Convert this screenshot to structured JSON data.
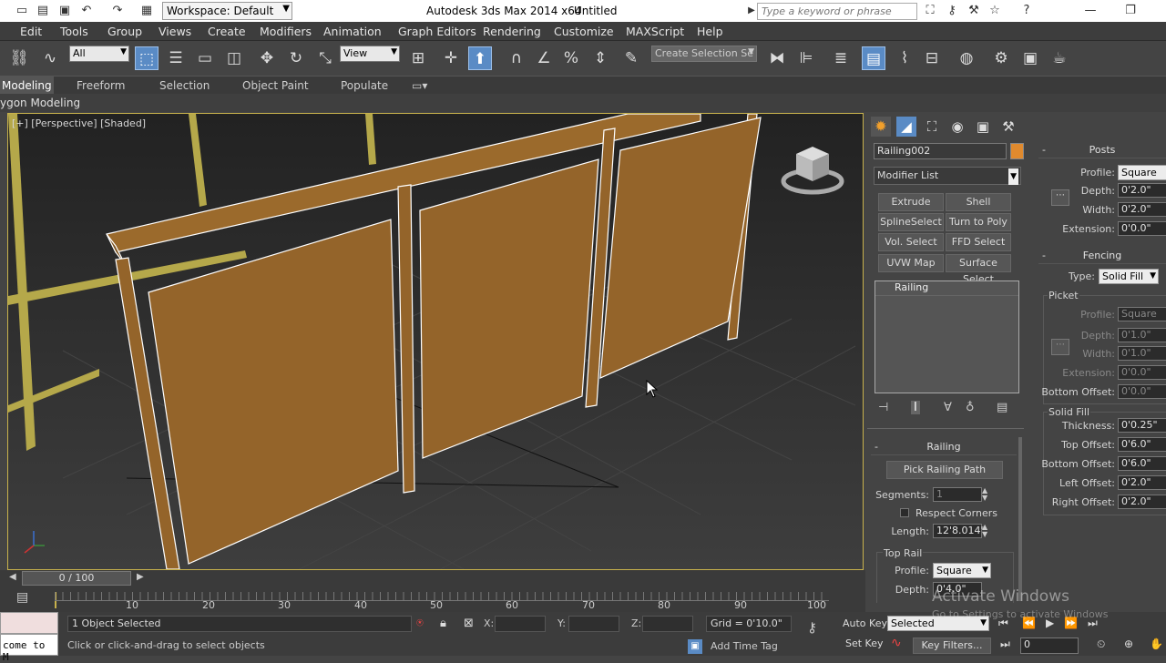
{
  "titlebar": {
    "workspace": "Workspace: Default",
    "title": "Autodesk 3ds Max  2014 x64",
    "file": "Untitled",
    "search_placeholder": "Type a keyword or phrase"
  },
  "menu": [
    "Edit",
    "Tools",
    "Group",
    "Views",
    "Create",
    "Modifiers",
    "Animation",
    "Graph Editors",
    "Rendering",
    "Customize",
    "MAXScript",
    "Help"
  ],
  "toolbar": {
    "filter_value": "All",
    "refcoord_value": "View",
    "selection_set_placeholder": "Create Selection Se"
  },
  "ribbon": {
    "tabs": [
      "Modeling",
      "Freeform",
      "Selection",
      "Object Paint",
      "Populate"
    ],
    "subtitle": "ygon Modeling"
  },
  "viewport": {
    "label": "[+] [Perspective] [Shaded]",
    "wood_color": "#94642a",
    "grid_color": "#3c3c3c",
    "border_color": "#c8b24c"
  },
  "command_panel": {
    "object_name": "Railing002",
    "object_color": "#e08a2e",
    "modifier_list": "Modifier List",
    "modifier_buttons": [
      "Extrude",
      "Shell",
      "SplineSelect",
      "Turn to Poly",
      "Vol. Select",
      "FFD Select",
      "UVW Map",
      "Surface Select"
    ],
    "stack_item": "Railing",
    "railing_rollout": {
      "title": "Railing",
      "pick_button": "Pick Railing Path",
      "segments_label": "Segments:",
      "segments_value": "1",
      "respect_corners": "Respect Corners",
      "length_label": "Length:",
      "length_value": "12'8.014\"",
      "top_rail_label": "Top Rail",
      "profile_label": "Profile:",
      "profile_value": "Square",
      "depth_label": "Depth:",
      "depth_value": "0'4.0\""
    },
    "posts_rollout": {
      "title": "Posts",
      "profile_label": "Profile:",
      "profile_value": "Square",
      "depth_label": "Depth:",
      "depth_value": "0'2.0\"",
      "width_label": "Width:",
      "width_value": "0'2.0\"",
      "extension_label": "Extension:",
      "extension_value": "0'0.0\""
    },
    "fencing_rollout": {
      "title": "Fencing",
      "type_label": "Type:",
      "type_value": "Solid Fill",
      "picket_label": "Picket",
      "picket_profile_label": "Profile:",
      "picket_profile_value": "Square",
      "picket_depth_label": "Depth:",
      "picket_depth_value": "0'1.0\"",
      "picket_width_label": "Width:",
      "picket_width_value": "0'1.0\"",
      "picket_extension_label": "Extension:",
      "picket_extension_value": "0'0.0\"",
      "picket_bottom_offset_label": "Bottom Offset:",
      "picket_bottom_offset_value": "0'0.0\"",
      "solid_fill_label": "Solid Fill",
      "thickness_label": "Thickness:",
      "thickness_value": "0'0.25\"",
      "top_offset_label": "Top Offset:",
      "top_offset_value": "0'6.0\"",
      "bottom_offset_label": "Bottom Offset:",
      "bottom_offset_value": "0'6.0\"",
      "left_offset_label": "Left Offset:",
      "left_offset_value": "0'2.0\"",
      "right_offset_label": "Right Offset:",
      "right_offset_value": "0'2.0\""
    }
  },
  "timeline": {
    "frame_counter": "0 / 100",
    "ticks": [
      "10",
      "20",
      "30",
      "40",
      "50",
      "60",
      "70",
      "80",
      "90",
      "100"
    ]
  },
  "status": {
    "maxscript_text": "come to M",
    "objects_selected": "1 Object Selected",
    "prompt": "Click or click-and-drag to select objects",
    "x_label": "X:",
    "y_label": "Y:",
    "z_label": "Z:",
    "grid": "Grid = 0'10.0\"",
    "add_time_tag": "Add Time Tag",
    "auto_key": "Auto Key",
    "set_key": "Set Key",
    "selected": "Selected",
    "key_filters": "Key Filters...",
    "frame_value": "0",
    "watermark_title": "Activate Windows",
    "watermark_sub": "Go to Settings to activate Windows"
  }
}
